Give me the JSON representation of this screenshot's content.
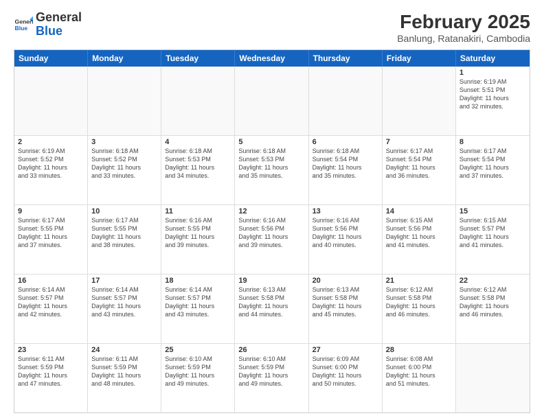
{
  "header": {
    "logo_general": "General",
    "logo_blue": "Blue",
    "main_title": "February 2025",
    "subtitle": "Banlung, Ratanakiri, Cambodia"
  },
  "weekdays": [
    "Sunday",
    "Monday",
    "Tuesday",
    "Wednesday",
    "Thursday",
    "Friday",
    "Saturday"
  ],
  "rows": [
    [
      {
        "day": "",
        "info": ""
      },
      {
        "day": "",
        "info": ""
      },
      {
        "day": "",
        "info": ""
      },
      {
        "day": "",
        "info": ""
      },
      {
        "day": "",
        "info": ""
      },
      {
        "day": "",
        "info": ""
      },
      {
        "day": "1",
        "info": "Sunrise: 6:19 AM\nSunset: 5:51 PM\nDaylight: 11 hours\nand 32 minutes."
      }
    ],
    [
      {
        "day": "2",
        "info": "Sunrise: 6:19 AM\nSunset: 5:52 PM\nDaylight: 11 hours\nand 33 minutes."
      },
      {
        "day": "3",
        "info": "Sunrise: 6:18 AM\nSunset: 5:52 PM\nDaylight: 11 hours\nand 33 minutes."
      },
      {
        "day": "4",
        "info": "Sunrise: 6:18 AM\nSunset: 5:53 PM\nDaylight: 11 hours\nand 34 minutes."
      },
      {
        "day": "5",
        "info": "Sunrise: 6:18 AM\nSunset: 5:53 PM\nDaylight: 11 hours\nand 35 minutes."
      },
      {
        "day": "6",
        "info": "Sunrise: 6:18 AM\nSunset: 5:54 PM\nDaylight: 11 hours\nand 35 minutes."
      },
      {
        "day": "7",
        "info": "Sunrise: 6:17 AM\nSunset: 5:54 PM\nDaylight: 11 hours\nand 36 minutes."
      },
      {
        "day": "8",
        "info": "Sunrise: 6:17 AM\nSunset: 5:54 PM\nDaylight: 11 hours\nand 37 minutes."
      }
    ],
    [
      {
        "day": "9",
        "info": "Sunrise: 6:17 AM\nSunset: 5:55 PM\nDaylight: 11 hours\nand 37 minutes."
      },
      {
        "day": "10",
        "info": "Sunrise: 6:17 AM\nSunset: 5:55 PM\nDaylight: 11 hours\nand 38 minutes."
      },
      {
        "day": "11",
        "info": "Sunrise: 6:16 AM\nSunset: 5:55 PM\nDaylight: 11 hours\nand 39 minutes."
      },
      {
        "day": "12",
        "info": "Sunrise: 6:16 AM\nSunset: 5:56 PM\nDaylight: 11 hours\nand 39 minutes."
      },
      {
        "day": "13",
        "info": "Sunrise: 6:16 AM\nSunset: 5:56 PM\nDaylight: 11 hours\nand 40 minutes."
      },
      {
        "day": "14",
        "info": "Sunrise: 6:15 AM\nSunset: 5:56 PM\nDaylight: 11 hours\nand 41 minutes."
      },
      {
        "day": "15",
        "info": "Sunrise: 6:15 AM\nSunset: 5:57 PM\nDaylight: 11 hours\nand 41 minutes."
      }
    ],
    [
      {
        "day": "16",
        "info": "Sunrise: 6:14 AM\nSunset: 5:57 PM\nDaylight: 11 hours\nand 42 minutes."
      },
      {
        "day": "17",
        "info": "Sunrise: 6:14 AM\nSunset: 5:57 PM\nDaylight: 11 hours\nand 43 minutes."
      },
      {
        "day": "18",
        "info": "Sunrise: 6:14 AM\nSunset: 5:57 PM\nDaylight: 11 hours\nand 43 minutes."
      },
      {
        "day": "19",
        "info": "Sunrise: 6:13 AM\nSunset: 5:58 PM\nDaylight: 11 hours\nand 44 minutes."
      },
      {
        "day": "20",
        "info": "Sunrise: 6:13 AM\nSunset: 5:58 PM\nDaylight: 11 hours\nand 45 minutes."
      },
      {
        "day": "21",
        "info": "Sunrise: 6:12 AM\nSunset: 5:58 PM\nDaylight: 11 hours\nand 46 minutes."
      },
      {
        "day": "22",
        "info": "Sunrise: 6:12 AM\nSunset: 5:58 PM\nDaylight: 11 hours\nand 46 minutes."
      }
    ],
    [
      {
        "day": "23",
        "info": "Sunrise: 6:11 AM\nSunset: 5:59 PM\nDaylight: 11 hours\nand 47 minutes."
      },
      {
        "day": "24",
        "info": "Sunrise: 6:11 AM\nSunset: 5:59 PM\nDaylight: 11 hours\nand 48 minutes."
      },
      {
        "day": "25",
        "info": "Sunrise: 6:10 AM\nSunset: 5:59 PM\nDaylight: 11 hours\nand 49 minutes."
      },
      {
        "day": "26",
        "info": "Sunrise: 6:10 AM\nSunset: 5:59 PM\nDaylight: 11 hours\nand 49 minutes."
      },
      {
        "day": "27",
        "info": "Sunrise: 6:09 AM\nSunset: 6:00 PM\nDaylight: 11 hours\nand 50 minutes."
      },
      {
        "day": "28",
        "info": "Sunrise: 6:08 AM\nSunset: 6:00 PM\nDaylight: 11 hours\nand 51 minutes."
      },
      {
        "day": "",
        "info": ""
      }
    ]
  ]
}
